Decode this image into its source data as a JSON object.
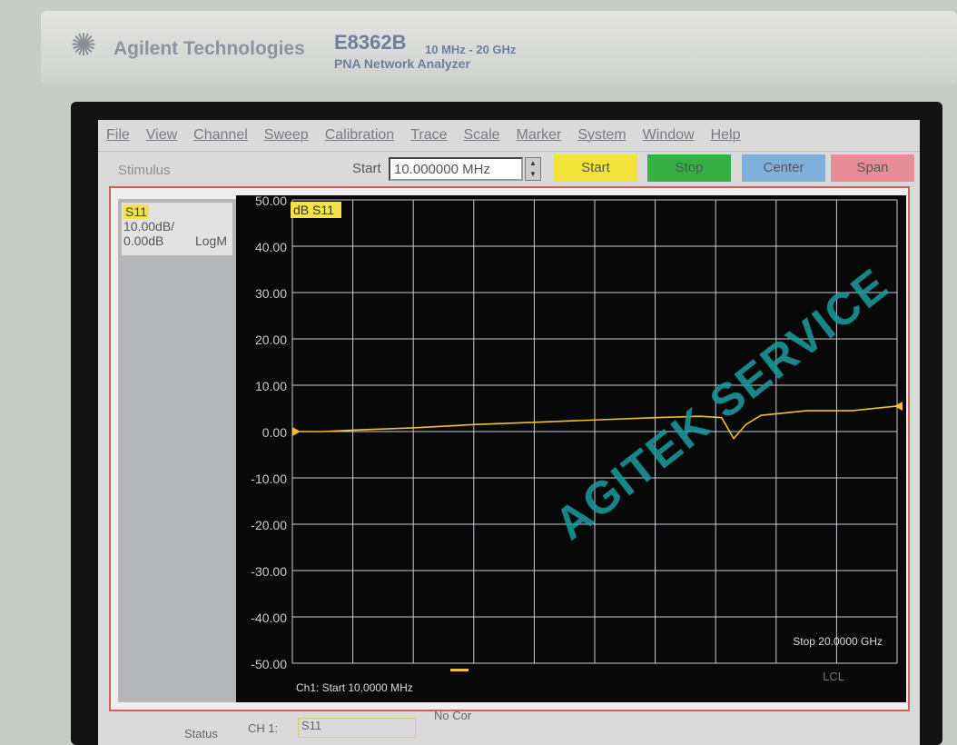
{
  "device": {
    "brand": "Agilent Technologies",
    "model": "E8362B",
    "range": "10 MHz - 20 GHz",
    "description": "PNA Network Analyzer"
  },
  "menu": [
    "File",
    "View",
    "Channel",
    "Sweep",
    "Calibration",
    "Trace",
    "Scale",
    "Marker",
    "System",
    "Window",
    "Help"
  ],
  "toolbar": {
    "group": "Stimulus",
    "field_label": "Start",
    "field_value": "10.000000 MHz",
    "buttons": [
      {
        "label": "Start",
        "color": "#f2e23a"
      },
      {
        "label": "Stop",
        "color": "#36b043"
      },
      {
        "label": "Center",
        "color": "#7fb0dc"
      },
      {
        "label": "Span",
        "color": "#e88c98"
      }
    ]
  },
  "trace_info": {
    "name": "S11",
    "scale": "10.00dB/",
    "ref": "0.00dB",
    "format": "LogM"
  },
  "chart_data": {
    "type": "line",
    "title": "dB S11",
    "xlim": [
      0.01,
      20
    ],
    "ylim": [
      -50,
      50
    ],
    "grid": true,
    "yticks": [
      "50.00",
      "40.00",
      "30.00",
      "20.00",
      "10.00",
      "0.00",
      "-10.00",
      "-20.00",
      "-30.00",
      "-40.00",
      "-50.00"
    ],
    "x_start_label": "Ch1: Start  10.0000 MHz",
    "x_stop_label": "Stop  20.0000 GHz",
    "trace_color": "#f2c02a",
    "series": [
      {
        "x": [
          0.01,
          1,
          2,
          4,
          6,
          8,
          10,
          12,
          13.5,
          14.2,
          14.6,
          15,
          15.5,
          17,
          18.5,
          20
        ],
        "y": [
          0,
          0,
          0.3,
          0.8,
          1.5,
          2,
          2.5,
          3,
          3.3,
          3,
          -1.5,
          1.5,
          3.5,
          4.5,
          4.5,
          5.5
        ]
      }
    ]
  },
  "status": {
    "label": "Status",
    "channel": "CH 1:",
    "param": "S11",
    "correction": "No Cor",
    "remote": "LCL"
  },
  "watermark": "AGITEK SERVICE"
}
